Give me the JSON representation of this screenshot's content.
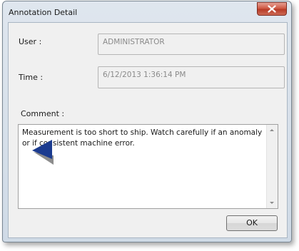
{
  "window": {
    "title": "Annotation Detail"
  },
  "fields": {
    "user_label": "User :",
    "user_value": "ADMINISTRATOR",
    "time_label": "Time :",
    "time_value": "6/12/2013 1:36:14 PM",
    "comment_label": "Comment :",
    "comment_value": "Measurement is too short to ship. Watch carefully if an anomaly or if consistent machine error."
  },
  "buttons": {
    "ok_label": "OK"
  },
  "icons": {
    "close": "close-icon",
    "pointer": "pointer-triangle-icon",
    "scroll_up": "chevron-up-icon",
    "scroll_down": "chevron-down-icon"
  },
  "colors": {
    "close_button": "#c94f3b",
    "pointer_primary": "#1b3b8f",
    "pointer_shadow": "#8c8c8c"
  }
}
